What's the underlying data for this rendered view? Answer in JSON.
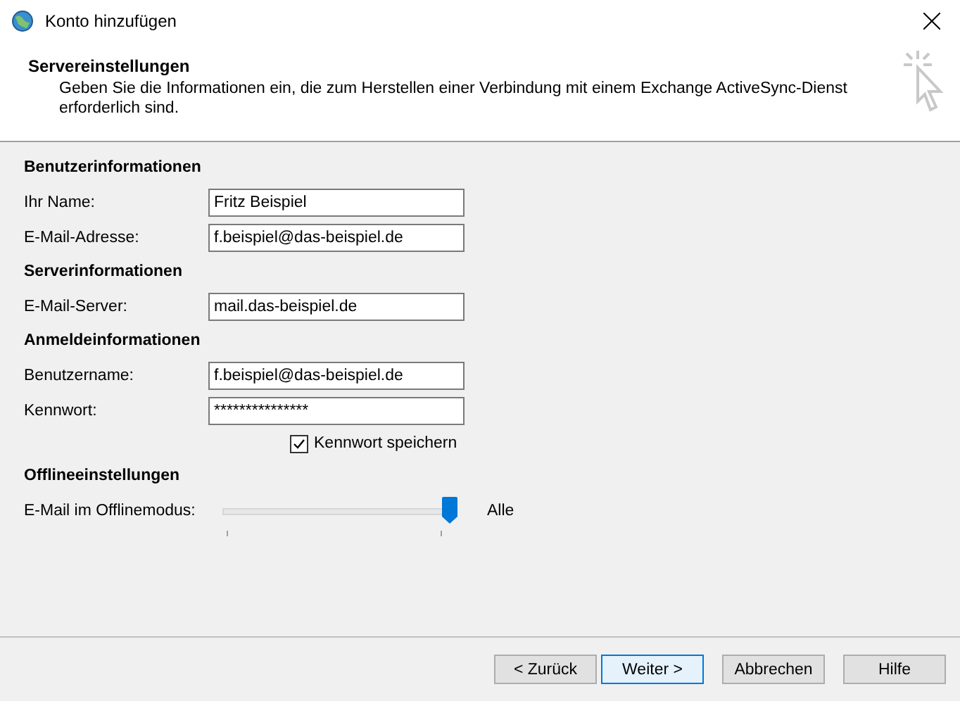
{
  "window": {
    "title": "Konto hinzufügen"
  },
  "header": {
    "title": "Servereinstellungen",
    "description": "Geben Sie die Informationen ein, die zum Herstellen einer Verbindung mit einem Exchange ActiveSync-Dienst erforderlich sind."
  },
  "sections": [
    {
      "heading": "Benutzerinformationen",
      "rows": [
        {
          "kind": "field",
          "label": "Ihr Name:",
          "value": "Fritz Beispiel"
        },
        {
          "kind": "field",
          "label": "E-Mail-Adresse:",
          "value": "f.beispiel@das-beispiel.de"
        }
      ]
    },
    {
      "heading": "Serverinformationen",
      "rows": [
        {
          "kind": "field",
          "label": "E-Mail-Server:",
          "value": "mail.das-beispiel.de"
        }
      ]
    },
    {
      "heading": "Anmeldeinformationen",
      "rows": [
        {
          "kind": "field",
          "label": "Benutzername:",
          "value": "f.beispiel@das-beispiel.de"
        },
        {
          "kind": "field",
          "label": "Kennwort:",
          "value": "***************"
        },
        {
          "kind": "checkbox",
          "label": "Kennwort speichern",
          "checked": true
        }
      ]
    },
    {
      "heading": "Offlineeinstellungen",
      "rows": [
        {
          "kind": "slider",
          "label": "E-Mail im Offlinemodus:",
          "level": 1,
          "reading": "Alle"
        }
      ]
    }
  ],
  "buttons": [
    {
      "label": "< Zurück",
      "default": false
    },
    {
      "label": "Weiter >",
      "default": true
    },
    {
      "label": "Abbrechen",
      "default": false
    },
    {
      "label": "Hilfe",
      "default": false
    }
  ]
}
